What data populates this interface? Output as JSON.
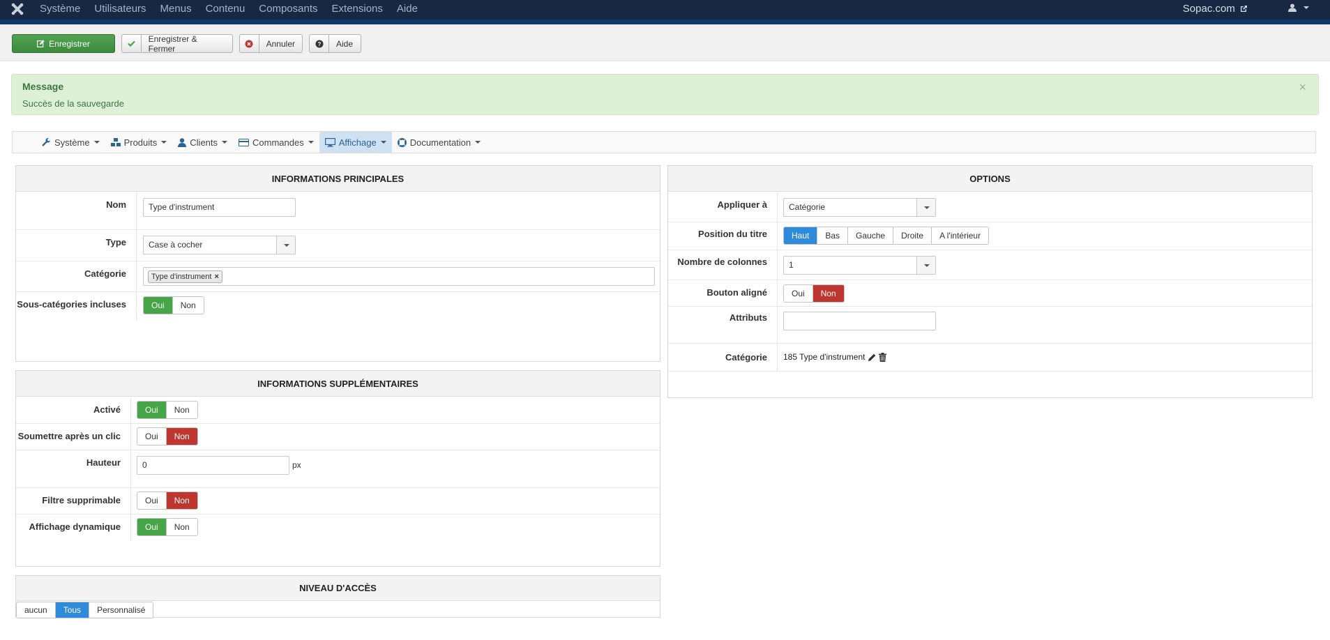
{
  "topbar": {
    "menu": [
      "Système",
      "Utilisateurs",
      "Menus",
      "Contenu",
      "Composants",
      "Extensions",
      "Aide"
    ],
    "site_link": "Sopac.com"
  },
  "toolbar": {
    "save": "Enregistrer",
    "save_close": "Enregistrer & Fermer",
    "cancel": "Annuler",
    "help": "Aide"
  },
  "alert": {
    "heading": "Message",
    "text": "Succès de la sauvegarde",
    "close": "×"
  },
  "compnav": {
    "items": [
      "Système",
      "Produits",
      "Clients",
      "Commandes",
      "Affichage",
      "Documentation"
    ],
    "active": "Affichage"
  },
  "main_info": {
    "title": "INFORMATIONS PRINCIPALES",
    "nom_label": "Nom",
    "nom_value": "Type d'instrument",
    "type_label": "Type",
    "type_value": "Case à cocher",
    "categorie_label": "Catégorie",
    "categorie_tag": "Type d'instrument",
    "souscat_label": "Sous-catégories incluses",
    "souscat_oui": "Oui",
    "souscat_non": "Non"
  },
  "extra_info": {
    "title": "INFORMATIONS SUPPLÉMENTAIRES",
    "active_label": "Activé",
    "submit_label": "Soumettre après un clic",
    "hauteur_label": "Hauteur",
    "hauteur_value": "0",
    "hauteur_unit": "px",
    "filtre_label": "Filtre supprimable",
    "dynamic_label": "Affichage dynamique",
    "oui": "Oui",
    "non": "Non"
  },
  "access": {
    "title": "NIVEAU D'ACCÈS",
    "options": [
      "aucun",
      "Tous",
      "Personnalisé"
    ],
    "selected": "Tous"
  },
  "options": {
    "title": "OPTIONS",
    "appliquer_label": "Appliquer à",
    "appliquer_value": "Catégorie",
    "position_label": "Position du titre",
    "position_options": [
      "Haut",
      "Bas",
      "Gauche",
      "Droite",
      "A l'intérieur"
    ],
    "position_selected": "Haut",
    "colonnes_label": "Nombre de colonnes",
    "colonnes_value": "1",
    "bouton_label": "Bouton aligné",
    "bouton_oui": "Oui",
    "bouton_non": "Non",
    "attributs_label": "Attributs",
    "attributs_value": "",
    "categorie_label": "Catégorie",
    "categorie_value": "185 Type d'instrument"
  },
  "colors": {
    "green": "#46a546",
    "red": "#bd362f",
    "blue": "#2f8ad9",
    "topbar": "#182842"
  }
}
